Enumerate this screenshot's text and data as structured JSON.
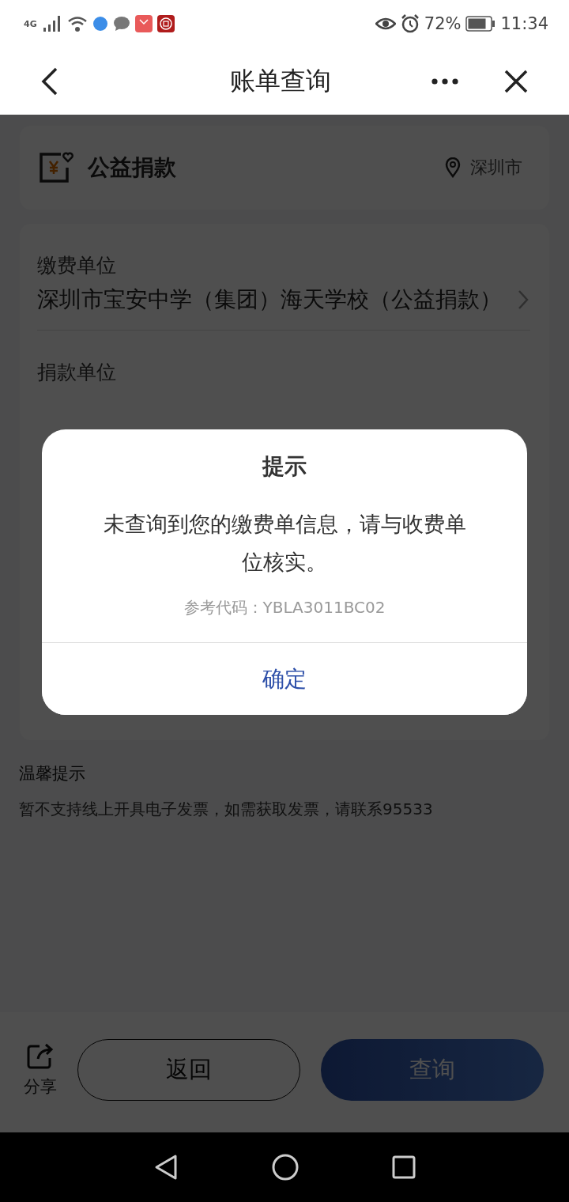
{
  "status_bar": {
    "network": "4G",
    "battery": "72%",
    "time": "11:34"
  },
  "nav_bar": {
    "title": "账单查询"
  },
  "category": {
    "title": "公益捐款",
    "city": "深圳市"
  },
  "form": {
    "fields": [
      {
        "label": "缴费单位",
        "value": "深圳市宝安中学（集团）海天学校（公益捐款）",
        "has_chevron": true
      },
      {
        "label": "捐款单位"
      }
    ]
  },
  "tips": {
    "title": "温馨提示",
    "text": "暂不支持线上开具电子发票，如需获取发票，请联系95533"
  },
  "bottom_bar": {
    "share": "分享",
    "back": "返回",
    "query": "查询"
  },
  "dialog": {
    "title": "提示",
    "message": "未查询到您的缴费单信息，请与收费单位核实。",
    "code": "参考代码：YBLA3011BC02",
    "confirm": "确定"
  }
}
